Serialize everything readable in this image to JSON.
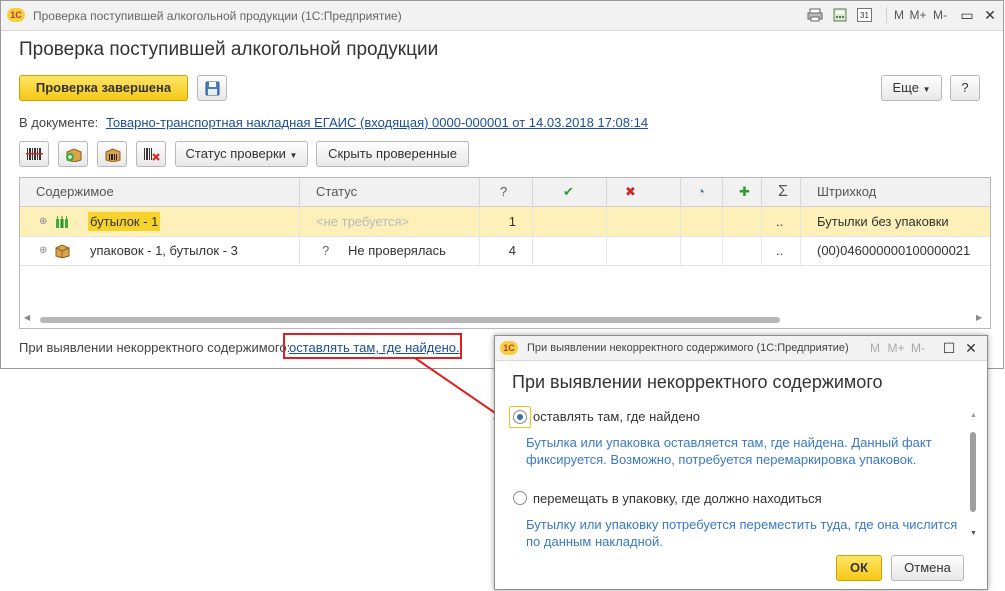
{
  "main_window": {
    "title": "Проверка поступившей алкогольной продукции  (1С:Предприятие)",
    "tool_m": "M",
    "tool_mplus": "M+",
    "tool_mminus": "M-",
    "cal_num": "31",
    "form_title": "Проверка поступившей алкогольной продукции",
    "btn_done": "Проверка завершена",
    "btn_more": "Еще",
    "btn_help": "?",
    "doc_label": "В документе:",
    "doc_link": "Товарно-транспортная накладная ЕГАИС (входящая) 0000-000001 от 14.03.2018 17:08:14",
    "btn_status": "Статус проверки",
    "btn_hide": "Скрыть проверенные",
    "bottom_label": "При выявлении некорректного содержимого:",
    "bottom_link": "оставлять там, где найдено."
  },
  "table": {
    "headers": {
      "content": "Содержимое",
      "status": "Статус",
      "q": "?",
      "ok": "✔",
      "err": "✖",
      "part": "◔",
      "plus": "✚",
      "sum": "Σ",
      "barcode": "Штрихкод"
    },
    "rows": [
      {
        "content": "бутылок -  1",
        "status": "<не требуется>",
        "q": "1",
        "sum": "..",
        "barcode": "Бутылки без упаковки"
      },
      {
        "content": "упаковок - 1, бутылок -  3",
        "status_icon": "?",
        "status": "Не проверялась",
        "q": "4",
        "sum": "..",
        "barcode": "(00)046000000100000021"
      }
    ]
  },
  "dialog": {
    "title": "При выявлении некорректного содержимого  (1С:Предприятие)",
    "tool_m": "M",
    "tool_mplus": "M+",
    "tool_mminus": "M-",
    "heading": "При выявлении некорректного содержимого",
    "opt1": "оставлять там, где найдено",
    "desc1_l1": "Бутылка или упаковка оставляется там, где найдена. Данный факт",
    "desc1_l2": "фиксируется. Возможно, потребуется перемаркировка упаковок.",
    "opt2": "перемещать в упаковку, где должно находиться",
    "desc2_l1": "Бутылку или упаковку потребуется переместить туда, где она числится",
    "desc2_l2": "по данным накладной.",
    "btn_ok": "ОК",
    "btn_cancel": "Отмена"
  },
  "colors": {
    "accent_yellow": "#f6c915",
    "link_blue": "#1a4f93",
    "desc_blue": "#3a79c1",
    "highlight_red": "#e02020",
    "selected_row": "#fdf0b8"
  }
}
